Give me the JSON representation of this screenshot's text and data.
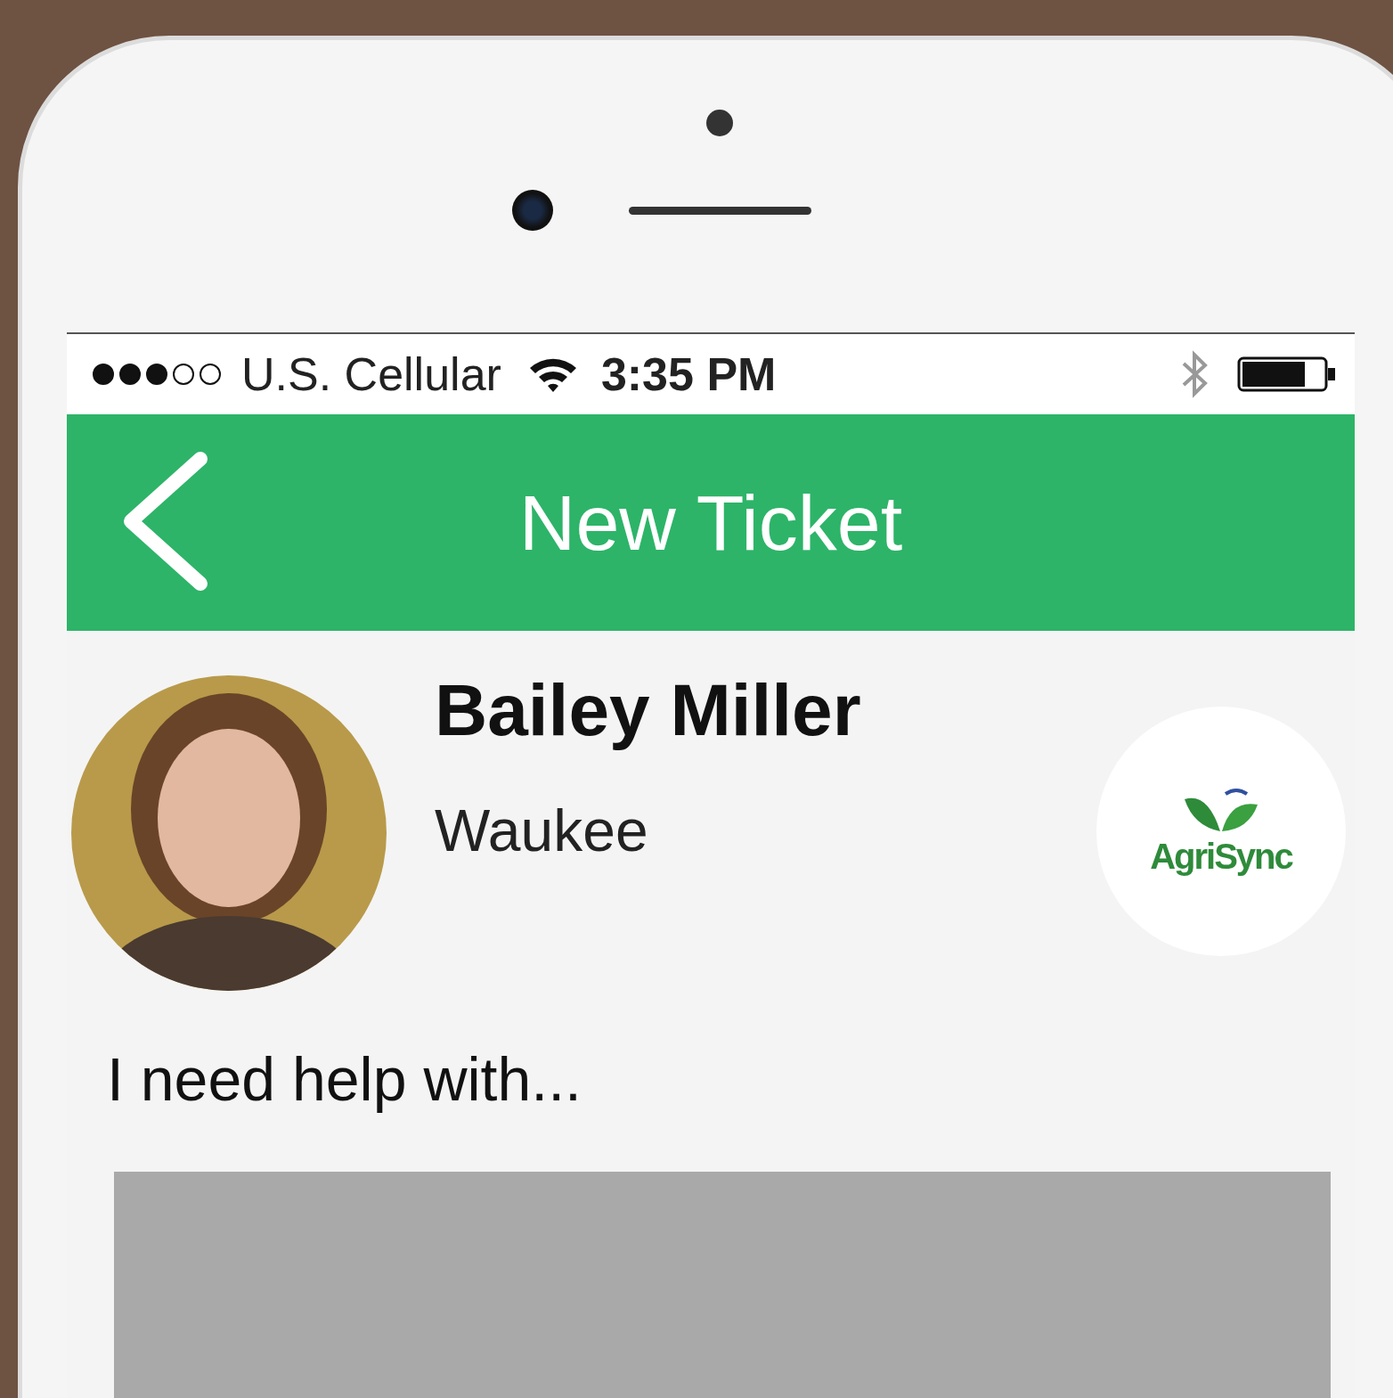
{
  "status_bar": {
    "carrier": "U.S. Cellular",
    "time": "3:35 PM"
  },
  "header": {
    "title": "New Ticket"
  },
  "profile": {
    "name": "Bailey Miller",
    "location": "Waukee",
    "logo_text": "AgriSync"
  },
  "prompt": "I need help with..."
}
